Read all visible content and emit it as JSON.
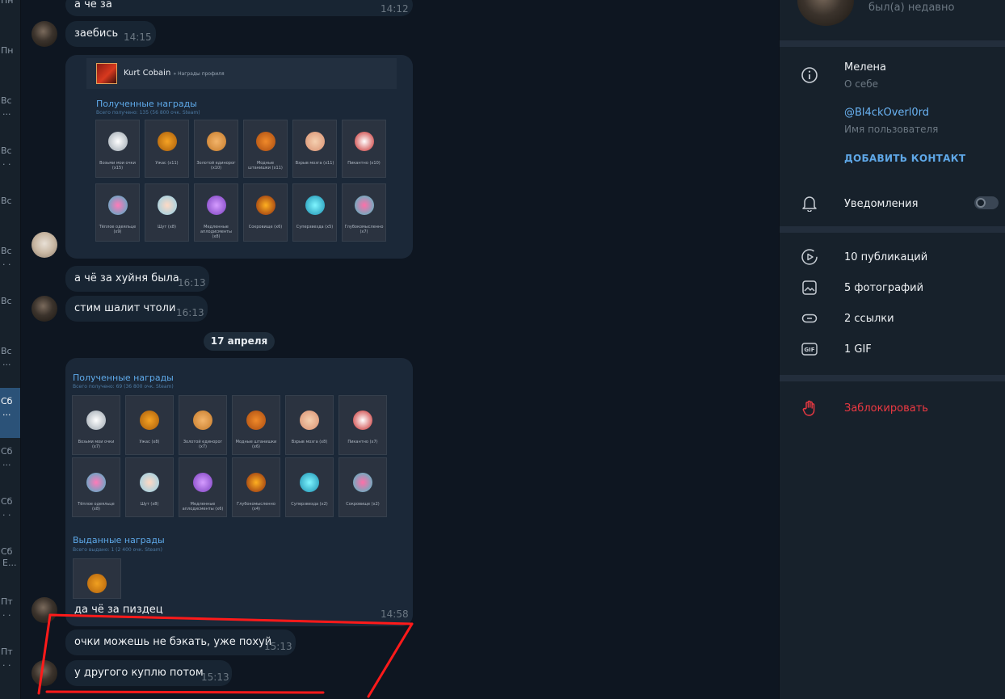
{
  "sidebar": {
    "items": [
      {
        "day": "Пн",
        "extra": ""
      },
      {
        "day": "Пн",
        "extra": ""
      },
      {
        "day": "Вс",
        "extra": "..."
      },
      {
        "day": "Вс",
        "extra": ". ."
      },
      {
        "day": "Вс",
        "extra": ""
      },
      {
        "day": "Вс",
        "extra": ". ."
      },
      {
        "day": "Вс",
        "extra": ""
      },
      {
        "day": "Вс",
        "extra": "..."
      },
      {
        "day": "Сб",
        "extra": "..."
      },
      {
        "day": "Сб",
        "extra": "..."
      },
      {
        "day": "Сб",
        "extra": ". ."
      },
      {
        "day": "Сб",
        "extra": "Е..."
      },
      {
        "day": "Пт",
        "extra": ". ."
      },
      {
        "day": "Пт",
        "extra": ". ."
      }
    ]
  },
  "chat": {
    "messages": [
      {
        "text": "а чё за",
        "time": "14:12"
      },
      {
        "text": "заебись",
        "time": "14:15"
      },
      {
        "text": "а чё за хуйня была",
        "time": "16:13"
      },
      {
        "text": "стим шалит чтоли",
        "time": "16:13"
      },
      {
        "text": "да чё за пиздец",
        "time": "14:58"
      },
      {
        "text": "очки можешь не бэкать, уже похуй",
        "time": "15:13"
      },
      {
        "text": "у другого куплю потом",
        "time": "15:13"
      }
    ],
    "date_separator": "17 апреля",
    "shot1": {
      "profile_name": "Kurt Cobain",
      "profile_sub": "» Награды профиля",
      "section_title": "Полученные награды",
      "section_sub": "Всего получено: 135 (56 800 очк. Steam)",
      "tiles": [
        "Возьми мои очки (x15)",
        "Ужас (x11)",
        "Золотой единорог (x10)",
        "Модные штанишки (x11)",
        "Взрыв мозга (x11)",
        "Пикантно (x10)",
        "Тёплое одеяльце (x9)",
        "Шут (x8)",
        "Медленные аплодисменты (x8)",
        "Сокровище (x6)",
        "Суперзвезда (x5)",
        "Глубокомысленно (x7)"
      ]
    },
    "shot2": {
      "section_title": "Полученные награды",
      "section_sub": "Всего получено: 69 (36 800 очк. Steam)",
      "tiles": [
        "Возьми мои очки (x7)",
        "Ужас (x8)",
        "Золотой единорог (x7)",
        "Модные штанишки (x6)",
        "Взрыв мозга (x8)",
        "Пикантно (x7)",
        "Тёплое одеяльце (x8)",
        "Шут (x8)",
        "Медленные аплодисменты (x6)",
        "Глубокомысленно (x4)",
        "Суперзвезда (x2)",
        "Сокровище (x2)"
      ],
      "given_title": "Выданные награды",
      "given_sub": "Всего выдано: 1 (2 400 очк. Steam)"
    }
  },
  "panel": {
    "status": "был(а) недавно",
    "bio": "Мелена",
    "bio_label": "О себе",
    "username": "@Bl4ckOverl0rd",
    "username_label": "Имя пользователя",
    "add_contact": "ДОБАВИТЬ КОНТАКТ",
    "notifications": "Уведомления",
    "media": {
      "posts": "10 публикаций",
      "photos": "5 фотографий",
      "links": "2 ссылки",
      "gifs": "1 GIF"
    },
    "block": "Заблокировать"
  },
  "colors": {
    "chat_bg": "#0e1621",
    "bubble": "#182533",
    "panel_bg": "#17212b",
    "accent": "#5fa8e8",
    "danger": "#ec3942",
    "annotation": "#ff1a1a"
  },
  "icons": [
    "info-icon",
    "bell-icon",
    "play-circle-icon",
    "image-icon",
    "link-icon",
    "gif-icon",
    "hand-stop-icon"
  ]
}
